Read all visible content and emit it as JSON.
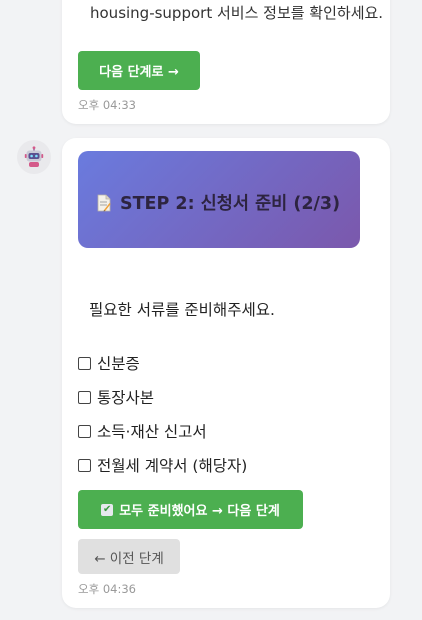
{
  "messages": [
    {
      "text": "housing-support 서비스 정보를 확인하세요.",
      "next_button": "다음 단계로 →",
      "time": "오후 04:33"
    },
    {
      "avatar_icon": "robot-icon",
      "step_title": "STEP 2: 신청서 준비 (2/3)",
      "instruction": "필요한 서류를 준비해주세요.",
      "checklist": [
        "신분증",
        "통장사본",
        "소득·재산 신고서",
        "전월세 계약서 (해당자)"
      ],
      "confirm_button": "모두 준비했어요 → 다음 단계",
      "prev_button": "← 이전 단계",
      "time": "오후 04:36"
    }
  ],
  "colors": {
    "accent_green": "#4caf50",
    "header_gradient_start": "#6a7bde",
    "header_gradient_end": "#7b58ac",
    "background": "#f2f3f5"
  }
}
